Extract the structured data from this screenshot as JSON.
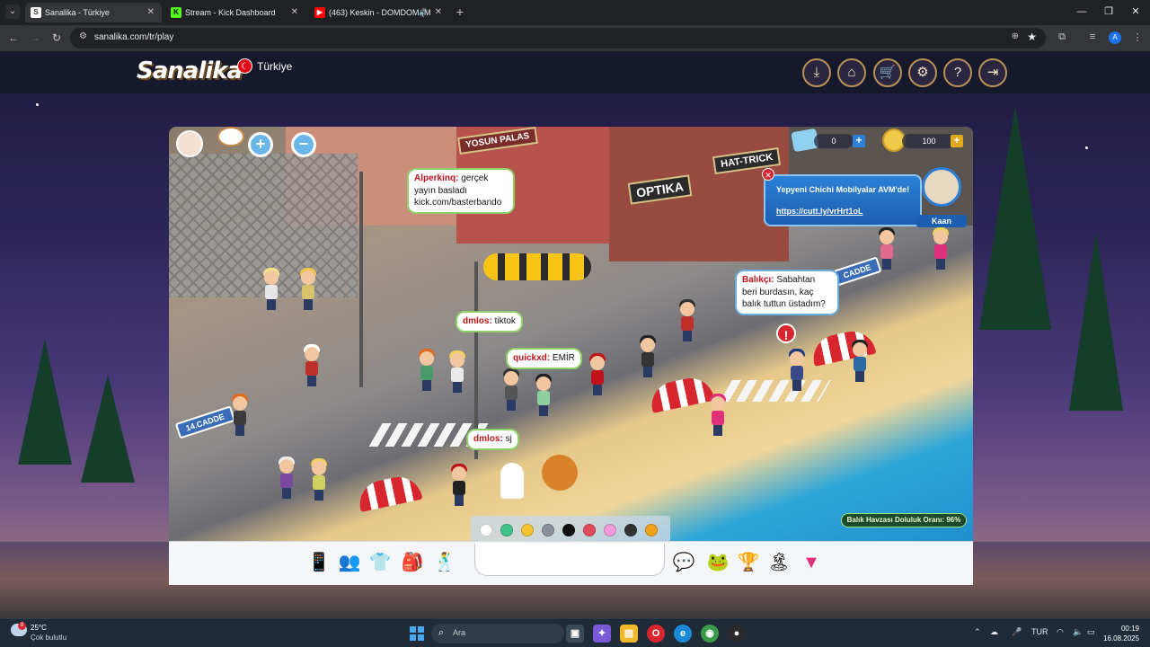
{
  "browser": {
    "tabs": [
      {
        "title": "Sanalika - Türkiye",
        "active": true,
        "favicon": "sanalika-favicon",
        "color": "#ffffff"
      },
      {
        "title": "Stream - Kick Dashboard",
        "active": false,
        "favicon": "kick-favicon",
        "color": "#53fc18"
      },
      {
        "title": "(463) Keskin - DOMDOM (M",
        "active": false,
        "favicon": "youtube-favicon",
        "color": "#ff0000"
      }
    ],
    "url": "sanalika.com/tr/play"
  },
  "site": {
    "logo": "Sanalika",
    "region": "Türkiye",
    "header_buttons": [
      "download",
      "home",
      "shop",
      "settings",
      "help",
      "logout"
    ]
  },
  "game": {
    "diamonds": "0",
    "coins": "100",
    "signs": {
      "store1": "YOSUN PALAS",
      "store2": "OPTIKA",
      "store3": "HAT-TRICK",
      "street": "14.CADDE",
      "street2": "CADDE"
    },
    "chat_bubbles": [
      {
        "name": "Alperkinq:",
        "text": "gerçek yayın basladı kick.com/basterbando"
      },
      {
        "name": "dmlos:",
        "text": "tiktok"
      },
      {
        "name": "quickxd:",
        "text": "EMİR"
      },
      {
        "name": "dmlos:",
        "text": "sj"
      },
      {
        "name": "Balıkçı:",
        "text": "Sabahtan beri burdasın, kaç balık tuttun üstadım?"
      }
    ],
    "notification": {
      "text": "Yepyeni Chichi Mobilyalar AVM'de!",
      "link": "https://cutt.ly/vrHrt1oL"
    },
    "npc_name": "Kaan",
    "fullness": "Balık Havzası Doluluk Oranı: 96%",
    "swatch_colors": [
      "#ffffff",
      "#3ec48a",
      "#f4c430",
      "#8a8f98",
      "#111111",
      "#e04a5a",
      "#f39ad8",
      "#333333",
      "#f2a21a"
    ]
  },
  "taskbar": {
    "temp": "25°C",
    "weather": "Çok bulutlu",
    "weather_badge": "8",
    "search_placeholder": "Ara",
    "lang": "TUR",
    "time": "00:19",
    "date": "16.08.2025"
  }
}
